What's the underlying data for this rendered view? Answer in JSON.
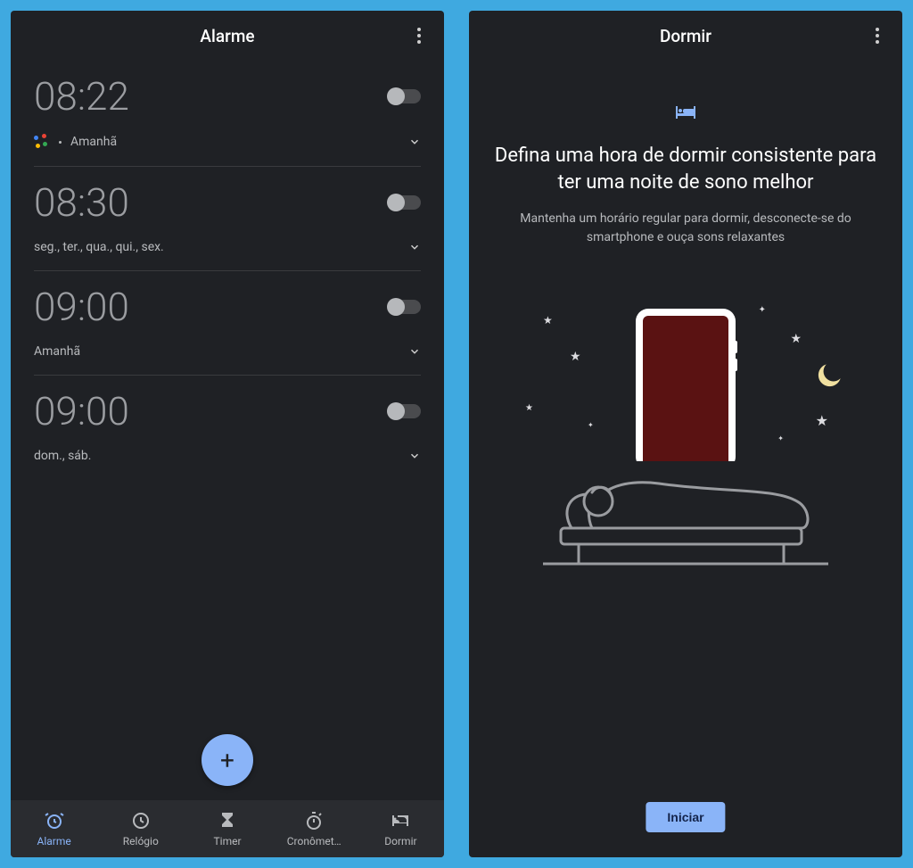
{
  "left": {
    "header": {
      "title": "Alarme"
    },
    "alarms": [
      {
        "time": "08:22",
        "label": "Amanhã",
        "hasAssistant": true,
        "enabled": false
      },
      {
        "time": "08:30",
        "label": "seg., ter., qua., qui., sex.",
        "hasAssistant": false,
        "enabled": false
      },
      {
        "time": "09:00",
        "label": "Amanhã",
        "hasAssistant": false,
        "enabled": false
      },
      {
        "time": "09:00",
        "label": "dom., sáb.",
        "hasAssistant": false,
        "enabled": false
      }
    ],
    "fab": {
      "glyph": "+"
    },
    "nav": {
      "items": [
        {
          "label": "Alarme",
          "icon": "alarm",
          "active": true
        },
        {
          "label": "Relógio",
          "icon": "clock",
          "active": false
        },
        {
          "label": "Timer",
          "icon": "hourglass",
          "active": false
        },
        {
          "label": "Cronômet…",
          "icon": "stopwatch",
          "active": false
        },
        {
          "label": "Dormir",
          "icon": "bed",
          "active": false
        }
      ]
    }
  },
  "right": {
    "header": {
      "title": "Dormir"
    },
    "heading": "Defina uma hora de dormir consistente para ter uma noite de sono melhor",
    "subheading": "Mantenha um horário regular para dormir, desconecte-se do smartphone e ouça sons relaxantes",
    "startButton": "Iniciar"
  },
  "colors": {
    "accent": "#8ab4f8",
    "background": "#1f2125",
    "appBackground": "#3fa9e0"
  }
}
